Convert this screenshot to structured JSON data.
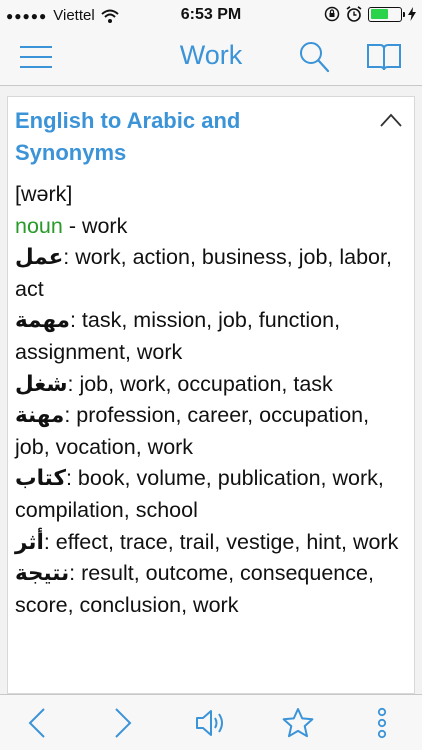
{
  "status_bar": {
    "carrier": "Viettel",
    "time": "6:53 PM",
    "battery_level": 0.6,
    "battery_color": "#2bd34a"
  },
  "nav": {
    "title": "Work",
    "icons": [
      "menu-icon",
      "search-icon",
      "book-icon"
    ]
  },
  "section": {
    "title": "English to Arabic and Synonyms",
    "collapse_icon": "chevron-up-icon"
  },
  "entry": {
    "pronunciation": "[wərk]",
    "part_of_speech": "noun",
    "headword_suffix": " - work",
    "translations": [
      {
        "arabic": "عمل",
        "synonyms": "work, action, business, job, labor, act"
      },
      {
        "arabic": "مهمة",
        "synonyms": "task, mission, job, function, assignment, work"
      },
      {
        "arabic": "شغل",
        "synonyms": "job, work, occupation, task"
      },
      {
        "arabic": "مهنة",
        "synonyms": "profession, career, occupation, job, vocation, work"
      },
      {
        "arabic": "كتاب",
        "synonyms": "book, volume, publication, work, compilation, school"
      },
      {
        "arabic": "أثر",
        "synonyms": "effect, trace, trail, vestige, hint, work"
      },
      {
        "arabic": "نتيجة",
        "synonyms": "result, outcome, consequence, score, conclusion, work"
      }
    ]
  },
  "toolbar": {
    "icons": [
      "back-icon",
      "forward-icon",
      "speaker-icon",
      "star-icon",
      "more-icon"
    ]
  },
  "colors": {
    "accent": "#3b93d8",
    "part_of_speech": "#2a9a2a"
  }
}
